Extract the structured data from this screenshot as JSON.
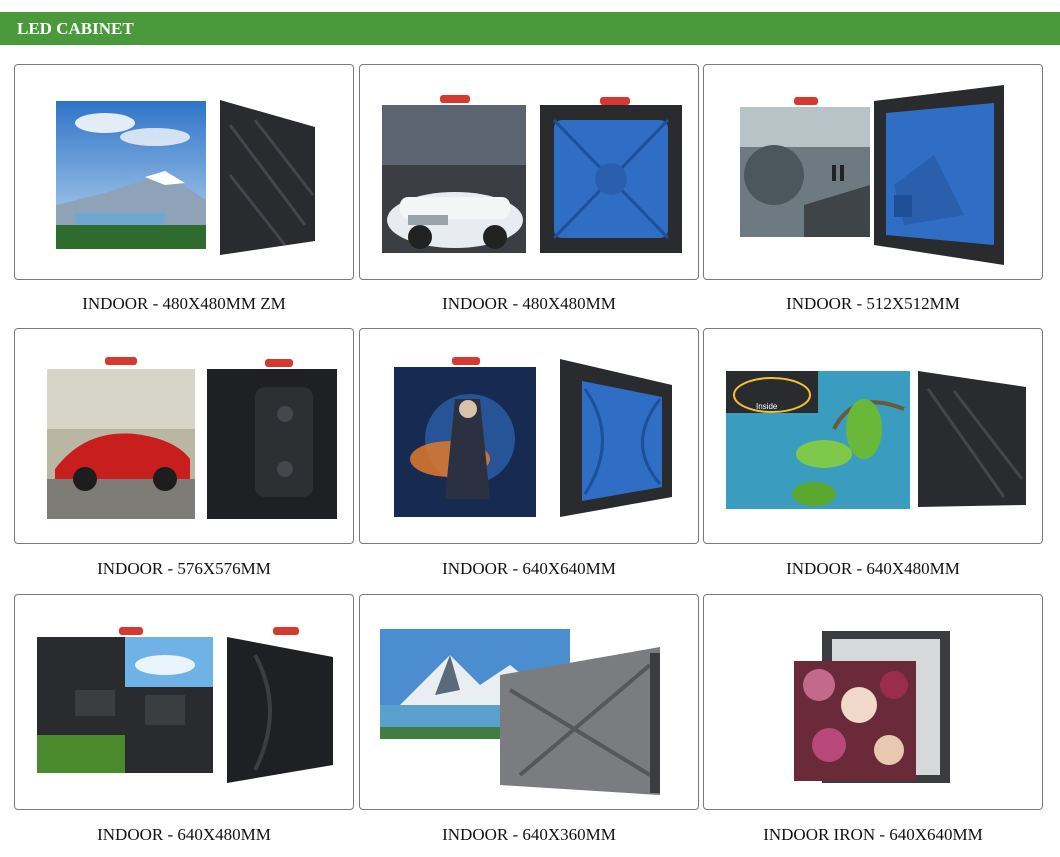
{
  "header": {
    "title": "LED CABINET",
    "color": "#4a9a3c"
  },
  "products": [
    {
      "caption": "INDOOR - 480X480MM ZM",
      "image": "landscape-screen-and-dark-cabinet"
    },
    {
      "caption": "INDOOR - 480X480MM",
      "image": "car-screen-and-blue-cabinet"
    },
    {
      "caption": "INDOOR - 512X512MM",
      "image": "scifi-screen-and-blue-cabinet"
    },
    {
      "caption": "INDOOR - 576X576MM",
      "image": "sports-car-screen-and-black-cabinet"
    },
    {
      "caption": "INDOOR - 640X640MM",
      "image": "game-art-screen-and-blue-cabinet"
    },
    {
      "caption": "INDOOR - 640X480MM",
      "image": "leaf-screen-and-dark-cabinet"
    },
    {
      "caption": "INDOOR - 640X480MM",
      "image": "sky-screen-and-black-cabinet"
    },
    {
      "caption": "INDOOR - 640X360MM",
      "image": "mountain-screen-and-silver-cabinet"
    },
    {
      "caption": "INDOOR IRON - 640X640MM",
      "image": "flower-screen-and-iron-cabinet"
    }
  ],
  "colors": {
    "blue_panel": "#2f6ec4",
    "dark_cabinet": "#2a2b2e",
    "handle_red": "#d63a2e"
  }
}
